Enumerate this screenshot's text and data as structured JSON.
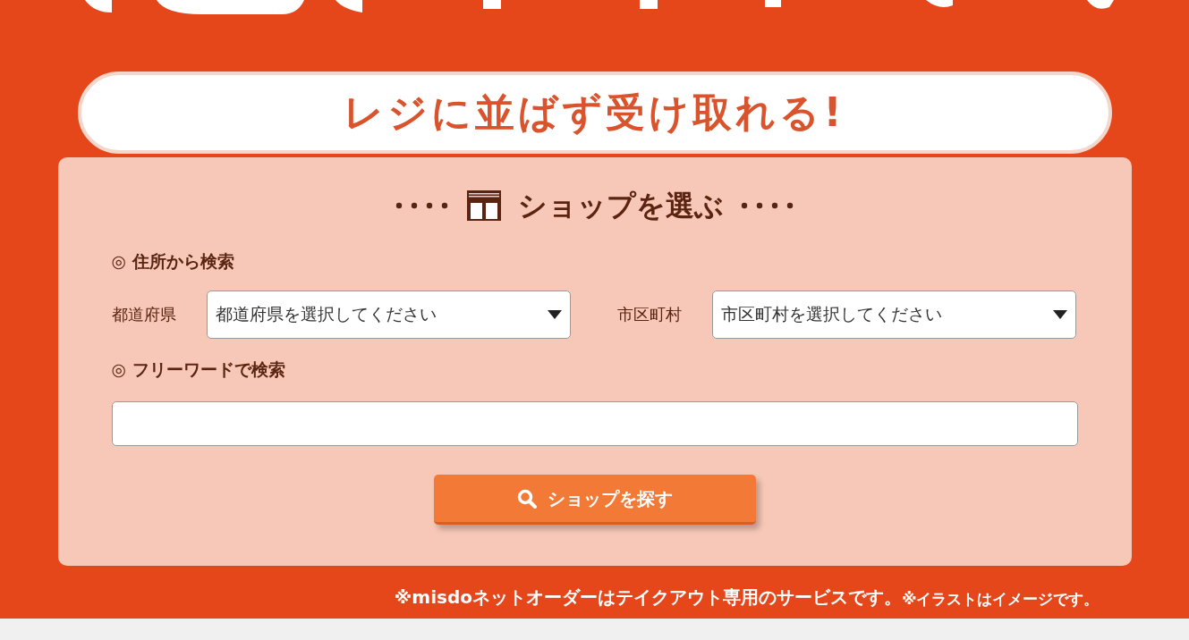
{
  "banner": {
    "text": "レジに並ばず受け取れる!"
  },
  "shop_panel": {
    "title": "ショップを選ぶ",
    "address_heading": "◎ 住所から検索",
    "selects": [
      {
        "label": "都道府県",
        "value": "都道府県を選択してください"
      },
      {
        "label": "市区町村",
        "value": "市区町村を選択してください"
      }
    ],
    "freeword_heading": "◎ フリーワードで検索",
    "search_button": "ショップを探す"
  },
  "notes": [
    {
      "kind": "main",
      "text": "※misdoネットオーダーはテイクアウト専用のサービスです。"
    },
    {
      "kind": "sub",
      "text": "※イラストはイメージです。"
    }
  ]
}
